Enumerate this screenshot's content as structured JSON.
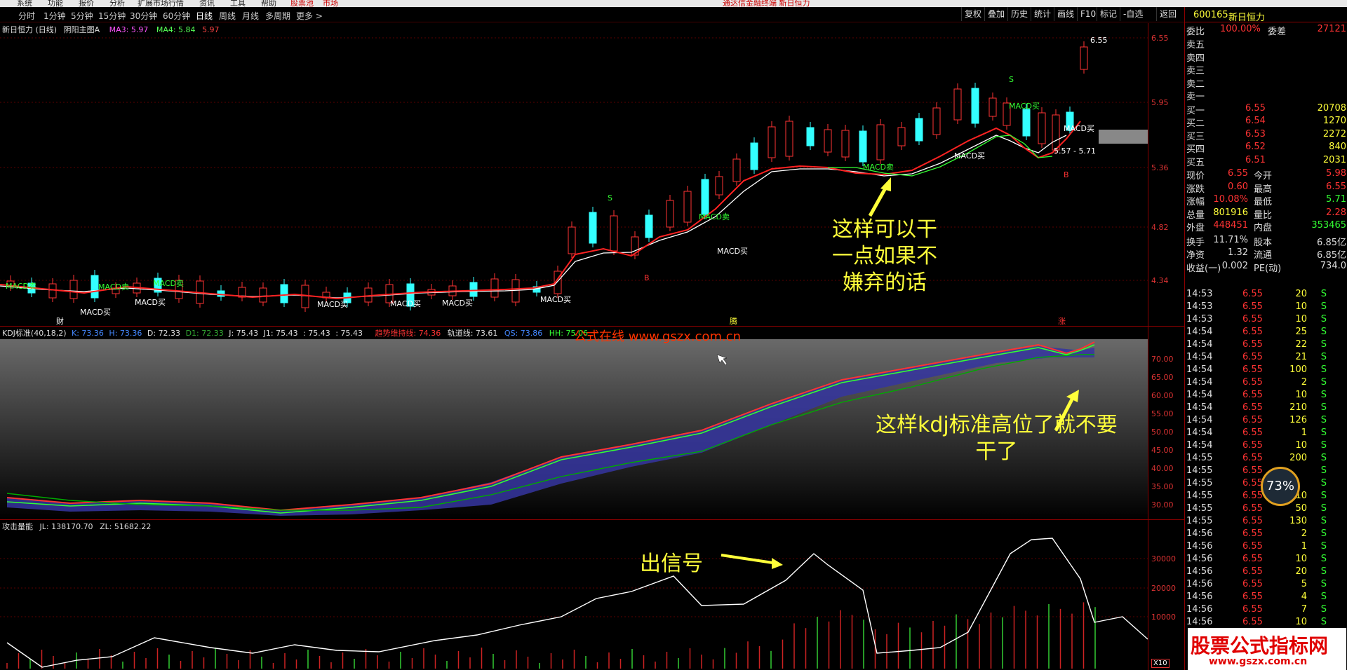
{
  "menu": [
    "系统",
    "功能",
    "报价",
    "分析",
    "扩展市场行情",
    "资讯",
    "工具",
    "帮助",
    "股票池",
    "市场"
  ],
  "title_bar": "通达信金融终端 新日恒力",
  "periods": [
    "分时",
    "1分钟",
    "5分钟",
    "15分钟",
    "30分钟",
    "60分钟",
    "日线",
    "周线",
    "月线",
    "多周期",
    "更多 >"
  ],
  "right_buttons": [
    "复权",
    "叠加",
    "历史",
    "统计",
    "画线",
    "F10",
    "标记",
    "-自选",
    "返回"
  ],
  "main_chart": {
    "title": "新日恒力 (日线)",
    "indicator": "阴阳主图A",
    "ma3": "MA3: 5.97",
    "ma4": "MA4: 5.84",
    "extra": "5.97",
    "y_ticks": [
      "6.55",
      "5.95",
      "5.36",
      "4.82",
      "4.34"
    ],
    "labels": [
      "MACD卖",
      "MACD卖",
      "MACD卖",
      "MACD卖",
      "MACD卖",
      "MACD买",
      "MACD买",
      "MACD买",
      "MACD买",
      "MACD买",
      "MACD买",
      "MACD买",
      "MACD买",
      "MACD买",
      "MACD买",
      "5.57 - 5.71",
      "6.55",
      "S",
      "S",
      "B",
      "B",
      "财",
      "腾",
      "涨"
    ]
  },
  "kdj": {
    "title": "KDJ标准(40,18,2)",
    "k": "K: 73.36",
    "h": "H: 73.36",
    "d": "D: 72.33",
    "d1": "D1: 72.33",
    "j": "J: 75.43",
    "j1": "J1: 75.43",
    "v1": ": 75.43",
    "v2": ": 75.43",
    "trend": "趋势维持线: 74.36",
    "track": "轨道线: 73.61",
    "qs": "QS: 73.86",
    "hh": "HH: 75.06",
    "watermark": "公式在线 www.gszx.com.cn",
    "y_ticks": [
      "70.00",
      "65.00",
      "60.00",
      "55.00",
      "50.00",
      "45.00",
      "40.00",
      "35.00",
      "30.00"
    ]
  },
  "volume": {
    "title": "攻击量能",
    "jl": "JL: 138170.70",
    "zl": "ZL: 51682.22",
    "y_ticks": [
      "30000",
      "20000",
      "10000"
    ],
    "scale": "X10"
  },
  "annotations": {
    "main": [
      "这样可以干",
      "一点如果不",
      "嫌弃的话"
    ],
    "kdj": [
      "这样kdj标准高位了就不要",
      "干了"
    ],
    "vol": "出信号"
  },
  "quote": {
    "code": "600165",
    "name": "新日恒力",
    "wb_label": "委比",
    "wb_value": "100.00%",
    "wc_label": "委差",
    "wc_value": "27121",
    "asks": [
      {
        "label": "卖五",
        "price": "",
        "vol": ""
      },
      {
        "label": "卖四",
        "price": "",
        "vol": ""
      },
      {
        "label": "卖三",
        "price": "",
        "vol": ""
      },
      {
        "label": "卖二",
        "price": "",
        "vol": ""
      },
      {
        "label": "卖一",
        "price": "",
        "vol": ""
      }
    ],
    "bids": [
      {
        "label": "买一",
        "price": "6.55",
        "vol": "20708"
      },
      {
        "label": "买二",
        "price": "6.54",
        "vol": "1270"
      },
      {
        "label": "买三",
        "price": "6.53",
        "vol": "2272"
      },
      {
        "label": "买四",
        "price": "6.52",
        "vol": "840"
      },
      {
        "label": "买五",
        "price": "6.51",
        "vol": "2031"
      }
    ],
    "stats": [
      {
        "l1": "现价",
        "v1": "6.55",
        "l2": "今开",
        "v2": "5.98"
      },
      {
        "l1": "涨跌",
        "v1": "0.60",
        "l2": "最高",
        "v2": "6.55"
      },
      {
        "l1": "涨幅",
        "v1": "10.08%",
        "l2": "最低",
        "v2": "5.71"
      },
      {
        "l1": "总量",
        "v1": "801916",
        "l2": "量比",
        "v2": "2.28"
      },
      {
        "l1": "外盘",
        "v1": "448451",
        "l2": "内盘",
        "v2": "353465"
      }
    ],
    "stats2": [
      {
        "l1": "换手",
        "v1": "11.71%",
        "l2": "股本",
        "v2": "6.85亿"
      },
      {
        "l1": "净资",
        "v1": "1.32",
        "l2": "流通",
        "v2": "6.85亿"
      },
      {
        "l1": "收益(一)",
        "v1": "0.002",
        "l2": "PE(动)",
        "v2": "734.0"
      }
    ]
  },
  "ticks": [
    {
      "t": "14:53",
      "p": "6.55",
      "v": "20",
      "s": "S"
    },
    {
      "t": "14:53",
      "p": "6.55",
      "v": "10",
      "s": "S"
    },
    {
      "t": "14:53",
      "p": "6.55",
      "v": "10",
      "s": "S"
    },
    {
      "t": "14:54",
      "p": "6.55",
      "v": "25",
      "s": "S"
    },
    {
      "t": "14:54",
      "p": "6.55",
      "v": "22",
      "s": "S"
    },
    {
      "t": "14:54",
      "p": "6.55",
      "v": "21",
      "s": "S"
    },
    {
      "t": "14:54",
      "p": "6.55",
      "v": "100",
      "s": "S"
    },
    {
      "t": "14:54",
      "p": "6.55",
      "v": "2",
      "s": "S"
    },
    {
      "t": "14:54",
      "p": "6.55",
      "v": "10",
      "s": "S"
    },
    {
      "t": "14:54",
      "p": "6.55",
      "v": "210",
      "s": "S"
    },
    {
      "t": "14:54",
      "p": "6.55",
      "v": "126",
      "s": "S"
    },
    {
      "t": "14:54",
      "p": "6.55",
      "v": "1",
      "s": "S"
    },
    {
      "t": "14:54",
      "p": "6.55",
      "v": "10",
      "s": "S"
    },
    {
      "t": "14:55",
      "p": "6.55",
      "v": "200",
      "s": "S"
    },
    {
      "t": "14:55",
      "p": "6.55",
      "v": "",
      "s": "S"
    },
    {
      "t": "14:55",
      "p": "6.55",
      "v": "",
      "s": "S"
    },
    {
      "t": "14:55",
      "p": "6.55",
      "v": "10",
      "s": "S"
    },
    {
      "t": "14:55",
      "p": "6.55",
      "v": "50",
      "s": "S"
    },
    {
      "t": "14:55",
      "p": "6.55",
      "v": "130",
      "s": "S"
    },
    {
      "t": "14:56",
      "p": "6.55",
      "v": "2",
      "s": "S"
    },
    {
      "t": "14:56",
      "p": "6.55",
      "v": "1",
      "s": "S"
    },
    {
      "t": "14:56",
      "p": "6.55",
      "v": "10",
      "s": "S"
    },
    {
      "t": "14:56",
      "p": "6.55",
      "v": "20",
      "s": "S"
    },
    {
      "t": "14:56",
      "p": "6.55",
      "v": "5",
      "s": "S"
    },
    {
      "t": "14:56",
      "p": "6.55",
      "v": "4",
      "s": "S"
    },
    {
      "t": "14:56",
      "p": "6.55",
      "v": "7",
      "s": "S"
    },
    {
      "t": "14:56",
      "p": "6.55",
      "v": "10",
      "s": "S"
    }
  ],
  "gauge": "73%",
  "logo": {
    "line1": "股票公式指标网",
    "line2": "www.gszx.com.cn"
  },
  "colors": {
    "up": "#ff3333",
    "down": "#33ffff",
    "yellow": "#ffff3a",
    "ma_white": "#ffffff",
    "axis_red": "#d33333"
  }
}
